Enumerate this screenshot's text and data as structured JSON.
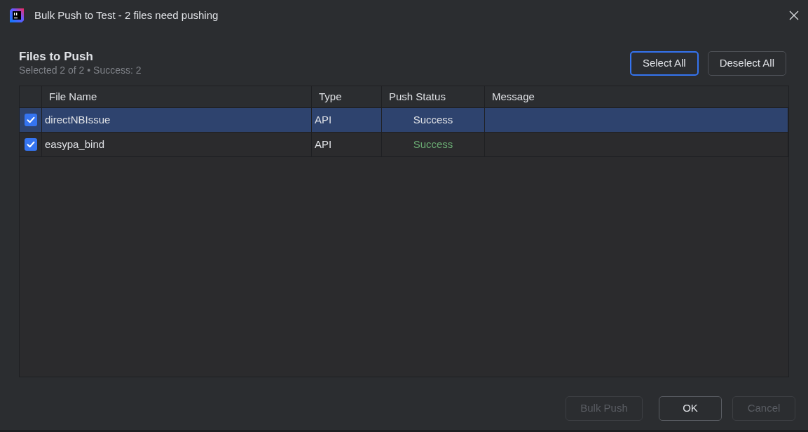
{
  "window": {
    "title": "Bulk Push to Test - 2 files need pushing"
  },
  "section": {
    "title": "Files to Push",
    "summary": "Selected 2 of 2 • Success: 2"
  },
  "toolbar_buttons": [
    {
      "label": "Select All",
      "focused": true
    },
    {
      "label": "Deselect All",
      "focused": false
    }
  ],
  "table": {
    "columns": [
      "File Name",
      "Type",
      "Push Status",
      "Message"
    ],
    "rows": [
      {
        "checked": true,
        "selected": true,
        "file_name": "directNBIssue",
        "type": "API",
        "push_status": "Success",
        "succeeded": true
      },
      {
        "checked": true,
        "selected": false,
        "file_name": "easypa_bind",
        "type": "API",
        "push_status": "Success",
        "succeeded": true
      }
    ]
  },
  "footer_buttons": [
    {
      "label": "Bulk Push",
      "disabled": true
    },
    {
      "label": "OK",
      "disabled": false
    },
    {
      "label": "Cancel",
      "disabled": true
    }
  ]
}
